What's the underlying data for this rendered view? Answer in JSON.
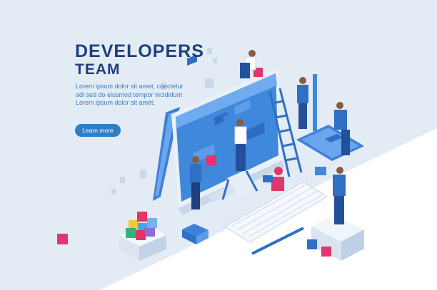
{
  "hero": {
    "title_line1": "DEVELOPERS",
    "title_line2": "TEAM",
    "body_lines": [
      "Lorem ipsum dolor sit amet, coectetur",
      "adi sed do eiusmod tempor incididunt",
      "Lorem ipsum dolor sit amet."
    ],
    "cta_label": "Learn more"
  },
  "colors": {
    "title": "#1f3f7d",
    "body_text": "#3a7ec6",
    "button": "#2f7ec7",
    "background_band": "#e3ebf4",
    "screen": "#3f88dc",
    "accent_pink": "#e2356d"
  }
}
